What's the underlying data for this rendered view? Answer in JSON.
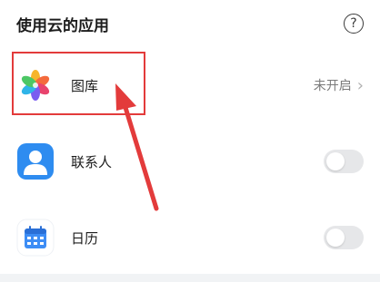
{
  "section": {
    "title": "使用云的应用",
    "help_icon": "question-circle-icon"
  },
  "apps": [
    {
      "label": "图库",
      "icon": "gallery-icon",
      "status": "未开启"
    },
    {
      "label": "联系人",
      "icon": "contacts-icon",
      "enabled": false
    },
    {
      "label": "日历",
      "icon": "calendar-icon",
      "enabled": false
    }
  ],
  "colors": {
    "highlight": "#e33b3b",
    "contacts_icon_bg": "#2e8cf0",
    "calendar_icon": "#3d8df5",
    "toggle_off": "#e6e7e9"
  }
}
